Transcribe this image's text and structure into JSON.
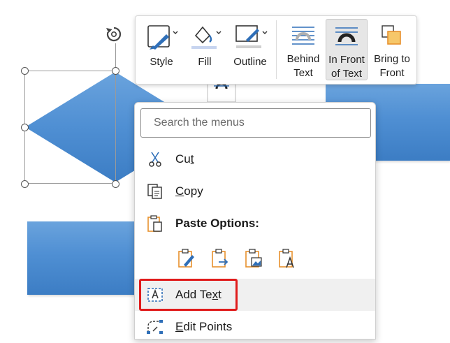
{
  "toolbar": {
    "buttons": [
      {
        "label": "Style",
        "icon": "shape-style-icon"
      },
      {
        "label": "Fill",
        "icon": "paint-bucket-icon"
      },
      {
        "label": "Outline",
        "icon": "shape-outline-icon"
      },
      {
        "label": "Behind\nText",
        "icon": "behind-text-icon"
      },
      {
        "label": "In Front\nof Text",
        "icon": "in-front-of-text-icon"
      },
      {
        "label": "Bring to\nFront",
        "icon": "bring-to-front-icon"
      }
    ]
  },
  "context_menu": {
    "search_placeholder": "Search the menus",
    "cut": {
      "pre": "Cu",
      "key": "t",
      "post": ""
    },
    "copy": {
      "pre": "",
      "key": "C",
      "post": "opy"
    },
    "paste_options": "Paste Options:",
    "add_text": {
      "pre": "Add Te",
      "key": "x",
      "post": "t"
    },
    "edit_points": {
      "pre": "",
      "key": "E",
      "post": "dit Points"
    }
  },
  "colors": {
    "shape_fill": "#4f8fd3",
    "highlight": "#e01b1b",
    "icon_accent": "#e8912d",
    "icon_blue": "#2f6fb8"
  }
}
